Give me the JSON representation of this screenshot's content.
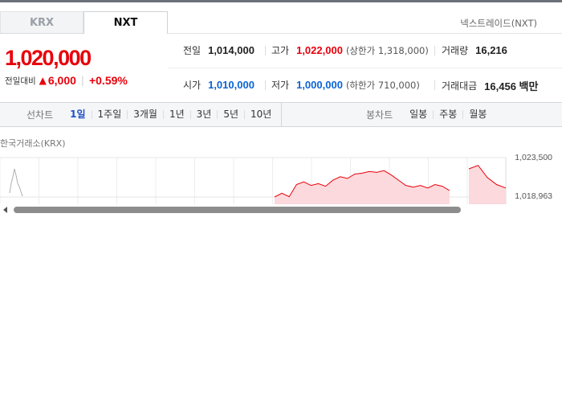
{
  "tabs": [
    {
      "label": "KRX",
      "active": false
    },
    {
      "label": "NXT",
      "active": true
    }
  ],
  "exchange_name": "넥스트레이드(NXT)",
  "quote": {
    "price": "1,020,000",
    "change_label": "전일대비",
    "change_direction": "up",
    "change_amount": "6,000",
    "change_percent": "+0.59%"
  },
  "stats": {
    "prev_close": {
      "label": "전일",
      "value": "1,014,000"
    },
    "high": {
      "label": "고가",
      "value": "1,022,000",
      "sub": "(상한가 1,318,000)"
    },
    "volume": {
      "label": "거래량",
      "value": "16,216"
    },
    "open": {
      "label": "시가",
      "value": "1,010,000"
    },
    "low": {
      "label": "저가",
      "value": "1,000,000",
      "sub": "(하한가 710,000)"
    },
    "amount": {
      "label": "거래대금",
      "value": "16,456 백만"
    }
  },
  "line_chart_controls": {
    "label": "선차트",
    "options": [
      "1일",
      "1주일",
      "3개월",
      "1년",
      "3년",
      "5년",
      "10년"
    ],
    "selected": "1일"
  },
  "candle_chart_controls": {
    "label": "봉차트",
    "options": [
      "일봉",
      "주봉",
      "월봉"
    ]
  },
  "chart_source": "한국거래소(KRX)",
  "colors": {
    "up": "#e8000b",
    "down": "#0b63d6",
    "selected": "#1e50c8"
  },
  "chart_data": {
    "type": "area",
    "title": "",
    "y_axis_labels": [
      "1,023,500",
      "1,018,963"
    ],
    "series": [
      {
        "values": [
          1018963,
          1019400,
          1019000,
          1020400,
          1020700,
          1020300,
          1020500,
          1020200,
          1020900,
          1021300,
          1021100,
          1021600,
          1021700,
          1021900,
          1021800,
          1022000,
          1021500,
          1020900,
          1020300,
          1020100,
          1020300,
          1020000,
          1020400,
          1020200,
          1019700
        ]
      },
      {
        "values": [
          1022200,
          1022600,
          1021200,
          1020400,
          1020000
        ]
      }
    ],
    "grid": true
  }
}
